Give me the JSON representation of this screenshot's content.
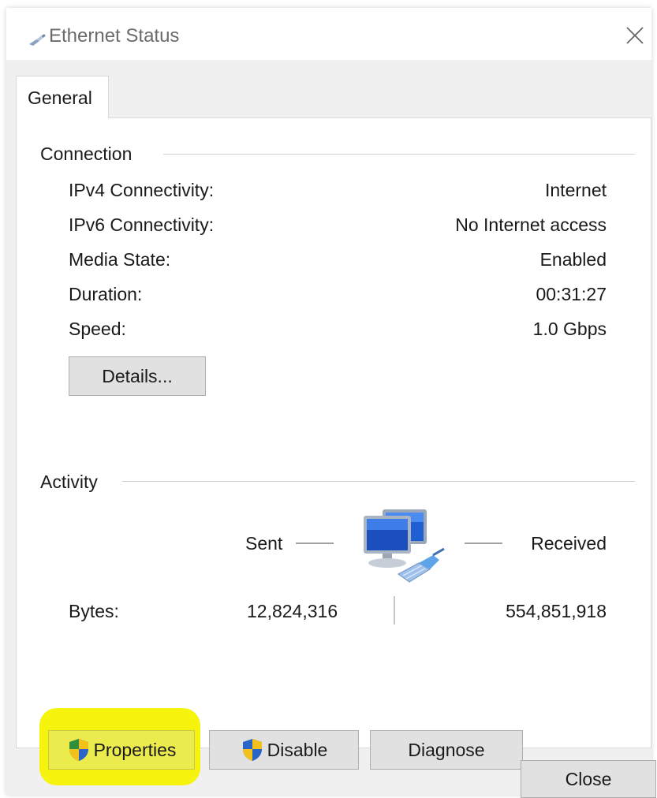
{
  "window": {
    "title": "Ethernet Status",
    "title_icon": "network-adapter-icon",
    "close_icon": "close-icon"
  },
  "tabs": [
    {
      "label": "General",
      "active": true
    }
  ],
  "connection": {
    "group_title": "Connection",
    "rows": [
      {
        "label": "IPv4 Connectivity:",
        "value": "Internet"
      },
      {
        "label": "IPv6 Connectivity:",
        "value": "No Internet access"
      },
      {
        "label": "Media State:",
        "value": "Enabled"
      },
      {
        "label": "Duration:",
        "value": "00:31:27"
      },
      {
        "label": "Speed:",
        "value": "1.0 Gbps"
      }
    ],
    "details_button": "Details..."
  },
  "activity": {
    "group_title": "Activity",
    "sent_label": "Sent",
    "received_label": "Received",
    "network_icon": "network-computers-icon",
    "bytes_label": "Bytes:",
    "bytes_sent": "12,824,316",
    "bytes_received": "554,851,918"
  },
  "actions": {
    "properties": "Properties",
    "disable": "Disable",
    "diagnose": "Diagnose",
    "shield_icon": "uac-shield-icon",
    "highlight_color": "#f6f200"
  },
  "footer": {
    "close": "Close"
  }
}
